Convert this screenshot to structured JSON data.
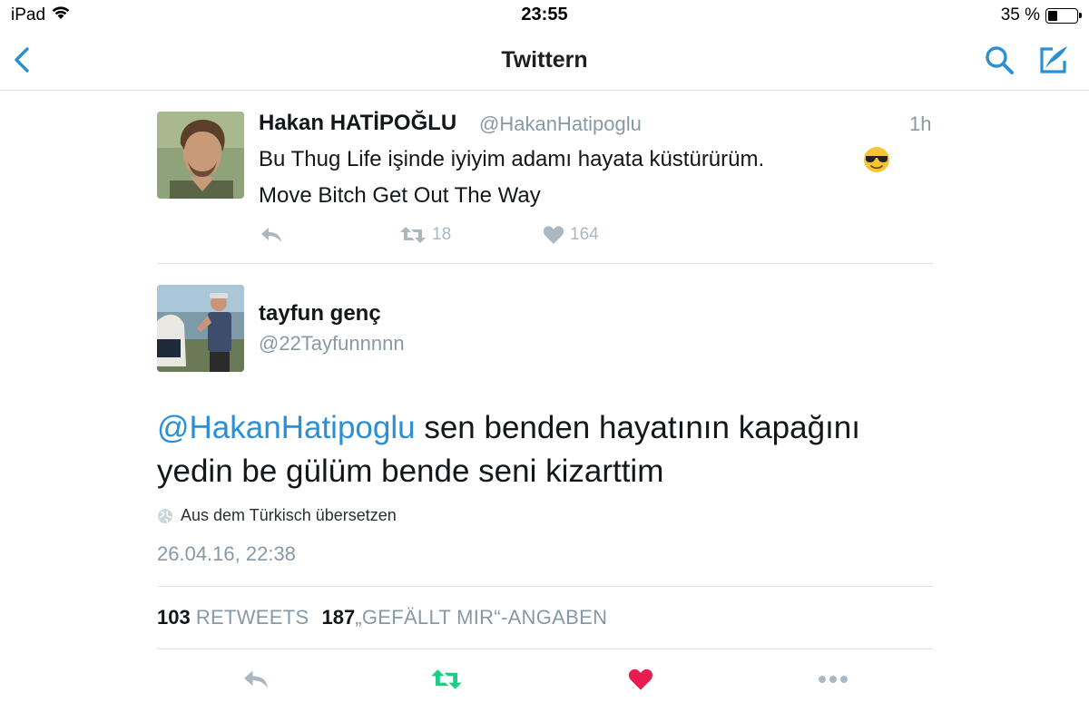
{
  "status_bar": {
    "device": "iPad",
    "time": "23:55",
    "battery": "35 %",
    "battery_level": 0.35
  },
  "nav": {
    "title": "Twittern",
    "icons": [
      "back-chevron-icon",
      "search-icon",
      "compose-icon"
    ],
    "accent": "#2b8fd6"
  },
  "quoted_tweet": {
    "name": "Hakan HATİPOĞLU",
    "handle": "@HakanHatipoglu",
    "time": "1h",
    "text_line1": "Bu Thug Life işinde iyiyim adamı hayata küstürürüm.",
    "text_line2": "Move Bitch Get Out The Way",
    "emoji": "sunglasses-face-emoji",
    "retweets": "18",
    "likes": "164"
  },
  "tweet": {
    "name": "tayfun genç",
    "handle": "@22Tayfunnnnn",
    "mention": "@HakanHatipoglu",
    "body_rest": " sen benden hayatının kapağını yedin be gülüm bende seni kizarttim",
    "translate_label": "Aus dem Türkisch übersetzen",
    "timestamp": "26.04.16, 22:38",
    "retweet_count": "103",
    "retweet_label": "RETWEETS",
    "like_count": "187",
    "like_label": "„GEFÄLLT MIR“-ANGABEN"
  },
  "colors": {
    "retweet_active": "#19cf86",
    "like_active": "#e81c4f",
    "muted": "#8899a6",
    "icon_muted": "#aab8c2"
  }
}
